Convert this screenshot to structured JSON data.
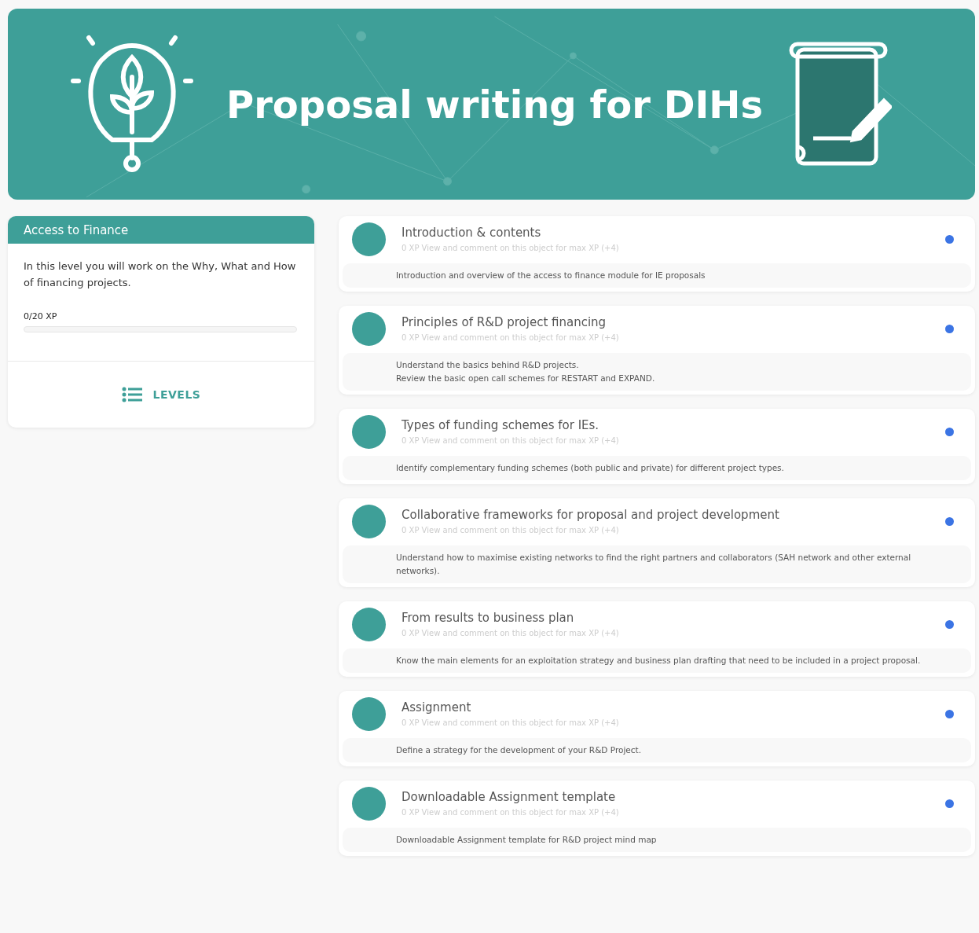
{
  "banner": {
    "title": "Proposal writing for DIHs"
  },
  "level_card": {
    "title": "Access to Finance",
    "description": "In this level you will work on the Why, What and How of financing projects.",
    "xp": "0/20 XP",
    "level": 0,
    "levels_button": "LEVELS"
  },
  "objects": [
    {
      "title": "Introduction & contents",
      "subtitle": "0 XP View and comment on this object for max XP (+4)",
      "description": [
        "Introduction and overview of the access to finance module for IE proposals"
      ],
      "unread": true
    },
    {
      "title": "Principles of R&D project financing",
      "subtitle": "0 XP View and comment on this object for max XP (+4)",
      "description": [
        "Understand the basics behind R&D projects.",
        "Review the basic open call schemes for RESTART and EXPAND."
      ],
      "unread": true
    },
    {
      "title": "Types of funding schemes for IEs.",
      "subtitle": "0 XP View and comment on this object for max XP (+4)",
      "description": [
        "Identify complementary funding schemes (both public and private) for different project types."
      ],
      "unread": true
    },
    {
      "title": "Collaborative frameworks for proposal and project development",
      "subtitle": "0 XP View and comment on this object for max XP (+4)",
      "description": [
        "Understand how to maximise existing networks to find the right partners and collaborators (SAH network and other external networks)."
      ],
      "unread": true
    },
    {
      "title": "From results to business plan",
      "subtitle": "0 XP View and comment on this object for max XP (+4)",
      "description": [
        "Know the main elements for an exploitation strategy and business plan drafting  that need to be included in a project proposal."
      ],
      "unread": true
    },
    {
      "title": "Assignment",
      "subtitle": "0 XP View and comment on this object for max XP (+4)",
      "description": [
        "Define a strategy for the development of your R&D Project."
      ],
      "unread": true
    },
    {
      "title": "Downloadable Assignment template",
      "subtitle": "0 XP View and comment on this object for max XP (+4)",
      "description": [
        "Downloadable Assignment template for R&D project mind map"
      ],
      "unread": true
    }
  ]
}
